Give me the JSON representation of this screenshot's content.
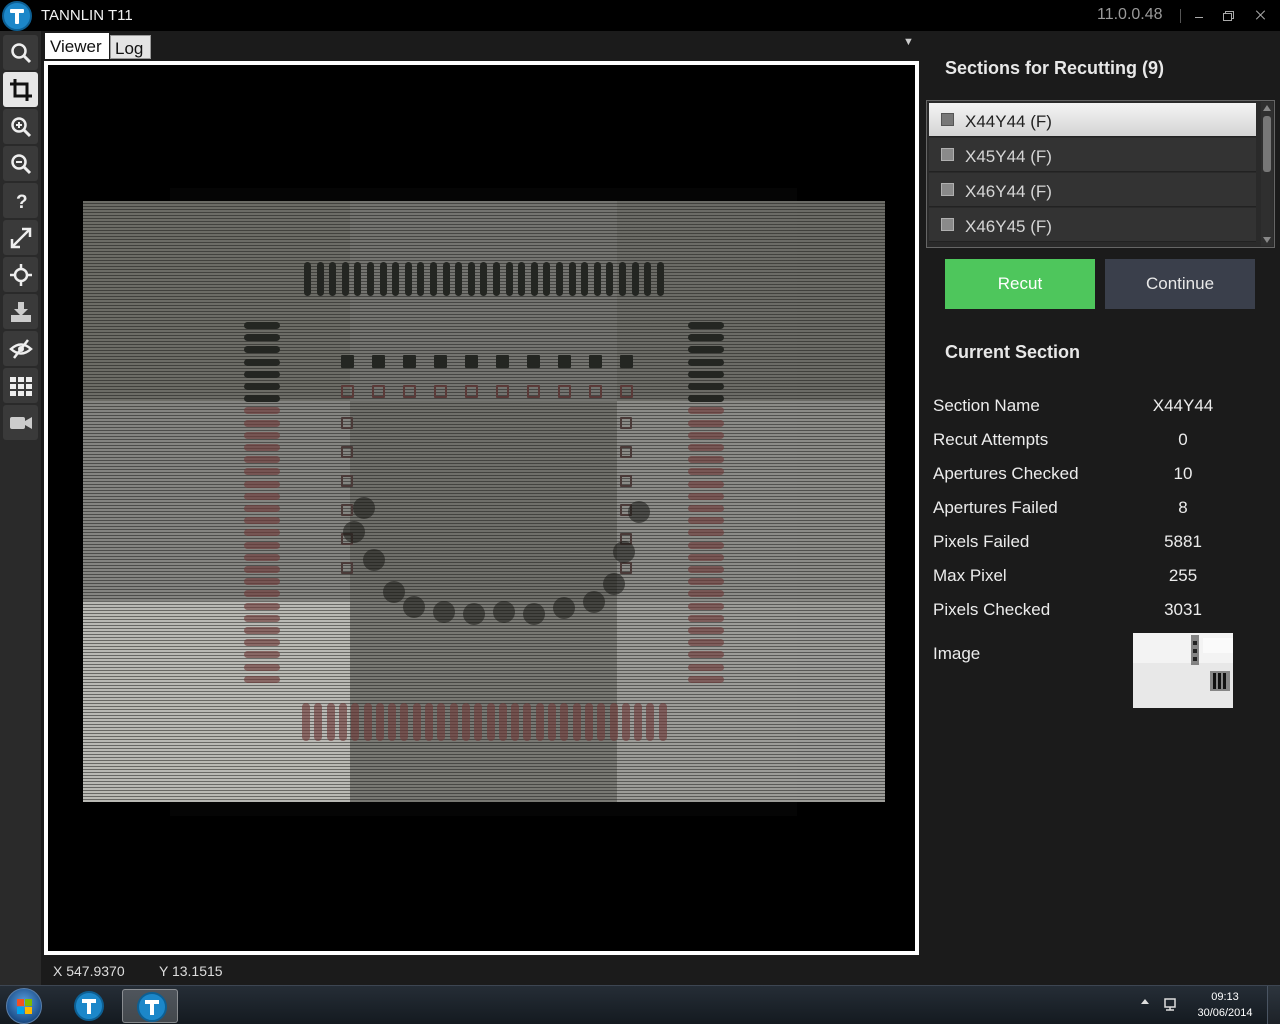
{
  "app": {
    "title": "TANNLIN T11",
    "version": "11.0.0.48"
  },
  "toolbar": {
    "tools": [
      {
        "icon": "magnifier-icon",
        "active": false
      },
      {
        "icon": "crop-icon",
        "active": true
      },
      {
        "icon": "zoom-in-icon",
        "active": false
      },
      {
        "icon": "zoom-out-icon",
        "active": false
      },
      {
        "icon": "help-icon",
        "active": false
      },
      {
        "icon": "expand-icon",
        "active": false
      },
      {
        "icon": "crosshair-icon",
        "active": false
      },
      {
        "icon": "download-icon",
        "active": false
      },
      {
        "icon": "hide-eye-icon",
        "active": false
      },
      {
        "icon": "grid-icon",
        "active": false
      },
      {
        "icon": "camera-icon",
        "active": false
      }
    ]
  },
  "tabs": {
    "viewer": "Viewer",
    "log": "Log"
  },
  "status": {
    "x": "X 547.9370",
    "y": "Y 13.1515"
  },
  "sections": {
    "title": "Sections for Recutting (9)",
    "items": [
      {
        "label": "X44Y44 (F)",
        "selected": true
      },
      {
        "label": "X45Y44 (F)",
        "selected": false
      },
      {
        "label": "X46Y44 (F)",
        "selected": false
      },
      {
        "label": "X46Y45 (F)",
        "selected": false
      }
    ]
  },
  "buttons": {
    "recut": "Recut",
    "continue": "Continue"
  },
  "current": {
    "title": "Current Section",
    "rows": [
      {
        "key": "Section Name",
        "value": "X44Y44"
      },
      {
        "key": "Recut Attempts",
        "value": "0"
      },
      {
        "key": "Apertures Checked",
        "value": "10"
      },
      {
        "key": "Apertures Failed",
        "value": "8"
      },
      {
        "key": "Pixels Failed",
        "value": "5881"
      },
      {
        "key": "Max Pixel",
        "value": "255"
      },
      {
        "key": "Pixels Checked",
        "value": "3031"
      }
    ],
    "image_label": "Image"
  },
  "taskbar": {
    "time": "09:13",
    "date": "30/06/2014"
  },
  "colors": {
    "accent_green": "#4ec65c",
    "continue_bg": "#3a3f4b",
    "brand_blue": "#1c87c9"
  }
}
